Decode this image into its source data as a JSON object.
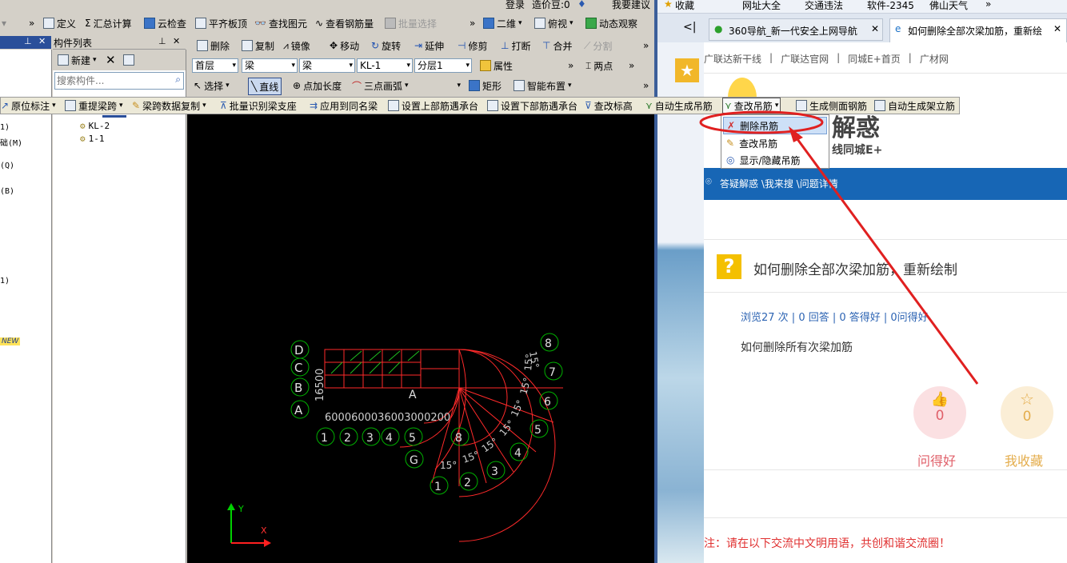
{
  "top_bar": {
    "login": "登录",
    "price_beans": "造价豆:0",
    "suggest": "我要建议"
  },
  "toolbar1": {
    "items": [
      "定义",
      "汇总计算",
      "云检查",
      "平齐板顶",
      "查找图元",
      "查看钢筋量",
      "批量选择"
    ],
    "right": [
      "二维",
      "俯视",
      "动态观察"
    ]
  },
  "toolbar2": {
    "items": [
      "删除",
      "复制",
      "镜像",
      "移动",
      "旋转",
      "延伸",
      "修剪",
      "打断",
      "合并",
      "分割"
    ]
  },
  "toolbar3": {
    "floor": "首层",
    "type1": "梁",
    "type2": "梁",
    "member": "KL-1",
    "layer": "分层1",
    "props": "属性",
    "twopoint": "两点"
  },
  "toolbar4": {
    "select": "选择",
    "line": "直线",
    "add_length": "点加长度",
    "arc": "三点画弧",
    "rect": "矩形",
    "smart": "智能布置"
  },
  "beam_toolbar": {
    "items": [
      "原位标注",
      "重提梁跨",
      "梁跨数据复制",
      "批量识别梁支座",
      "应用到同名梁",
      "设置上部筋遇承台",
      "设置下部筋遇承台",
      "查改标高",
      "自动生成吊筋",
      "查改吊筋",
      "生成侧面钢筋",
      "自动生成架立筋"
    ]
  },
  "dropdown": {
    "items": [
      "删除吊筋",
      "查改吊筋",
      "显示/隐藏吊筋"
    ]
  },
  "component_list": {
    "title": "构件列表",
    "new_label": "新建",
    "search_placeholder": "搜索构件...",
    "tree": [
      "KL-2",
      "1-1"
    ]
  },
  "left_panel": {
    "items": [
      "1)",
      "础(M)",
      "(Q)",
      "(B)",
      "1)"
    ],
    "new_badge": "NEW"
  },
  "cad": {
    "axis_rows": [
      "D",
      "C",
      "B",
      "A"
    ],
    "axis_cols": [
      "1",
      "2",
      "3",
      "4",
      "5",
      "6",
      "7",
      "8"
    ],
    "inner_cols": [
      "A",
      "B",
      "C",
      "D",
      "5",
      "6",
      "7",
      "8",
      "G"
    ],
    "radial_labels": [
      "1",
      "2",
      "3",
      "4",
      "5",
      "6",
      "7",
      "8"
    ],
    "angle_labels": [
      "15°",
      "15°",
      "15°",
      "15°",
      "15°",
      "15°",
      "15°",
      "15°"
    ],
    "dims_left": "16500",
    "dims_bottom": "6000600036003000200",
    "ucs_x": "X",
    "ucs_y": "Y"
  },
  "browser": {
    "favorites": [
      "收藏",
      "网址大全",
      "交通违法",
      "软件-2345",
      "佛山天气"
    ],
    "tabs": [
      "360导航_新一代安全上网导航",
      "如何删除全部次梁加筋，重新绘"
    ],
    "site_nav": [
      "广联达新干线",
      "广联达官网",
      "同城E+首页",
      "广材网"
    ],
    "logo_text": "解惑",
    "logo_sub": "线同城E+",
    "breadcrumb": "答疑解惑 \\我来搜 \\问题详情",
    "question_title": "如何删除全部次梁加筋，重新绘制",
    "stats": "浏览27 次 | 0 回答 | 0 答得好 | 0问得好",
    "question_body": "如何删除所有次梁加筋",
    "like_count": "0",
    "like_label": "问得好",
    "fav_count": "0",
    "fav_label": "我收藏",
    "notice": "注：请在以下交流中文明用语，共创和谐交流圈！"
  },
  "colors": {
    "cad_bg": "#000000",
    "grid_red": "#ff2a2a",
    "axis_green": "#00c000",
    "browser_blue": "#1766b5",
    "annotation_red": "#e02020",
    "fav_gold": "#f0c060",
    "like_pink": "#e0606a"
  }
}
